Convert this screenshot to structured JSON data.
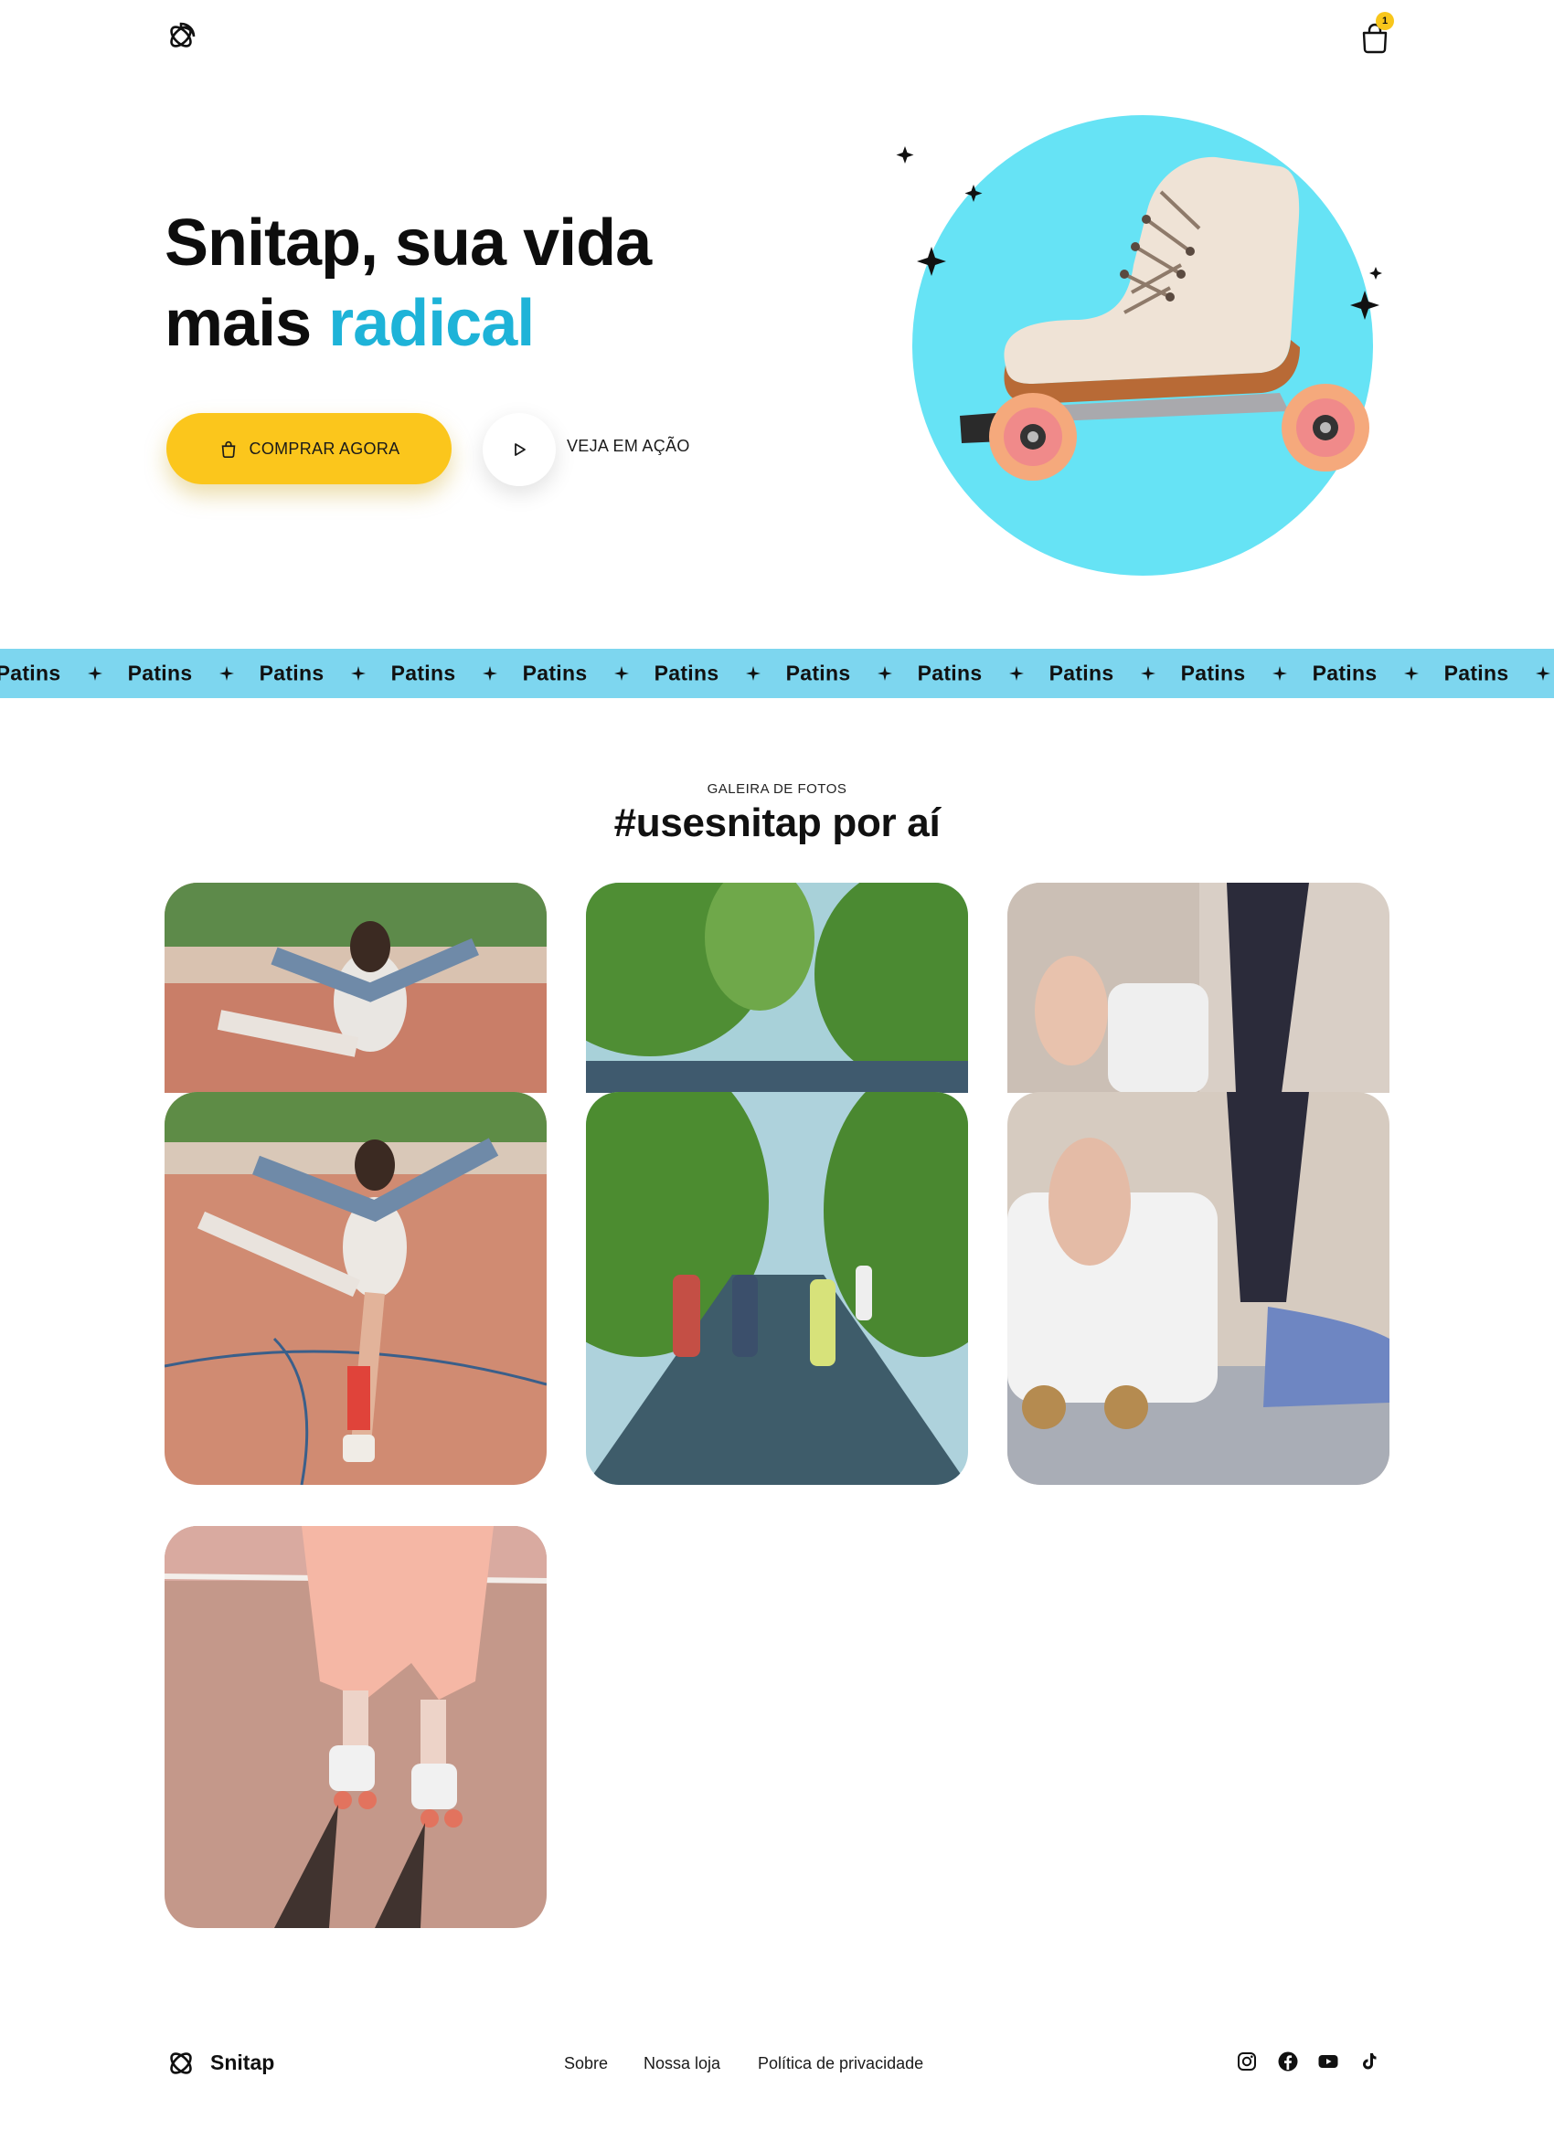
{
  "header": {
    "cart_badge": "1"
  },
  "hero": {
    "title_line1": "Snitap, sua vida",
    "title_line2_plain": "mais ",
    "title_line2_accent": "radical",
    "buy_button": "COMPRAR AGORA",
    "play_button": "VEJA EM AÇÃO"
  },
  "ticker": {
    "word": "Patins",
    "items": [
      "Patins",
      "Patins",
      "Patins",
      "Patins",
      "Patins",
      "Patins",
      "Patins",
      "Patins",
      "Patins",
      "Patins",
      "Patins",
      "Patins"
    ]
  },
  "gallery": {
    "eyebrow": "GALEIRA DE FOTOS",
    "title": "#usesnitap por aí"
  },
  "footer": {
    "brand": "Snitap",
    "links": [
      "Sobre",
      "Nossa loja",
      "Política de privacidade"
    ],
    "social_icons": [
      "instagram-icon",
      "facebook-icon",
      "youtube-icon",
      "tiktok-icon"
    ]
  },
  "colors": {
    "accent": "#1eb3d8",
    "button": "#fbc61c",
    "ticker": "#7dd6ef",
    "hero_circle": "#66e3f5"
  }
}
